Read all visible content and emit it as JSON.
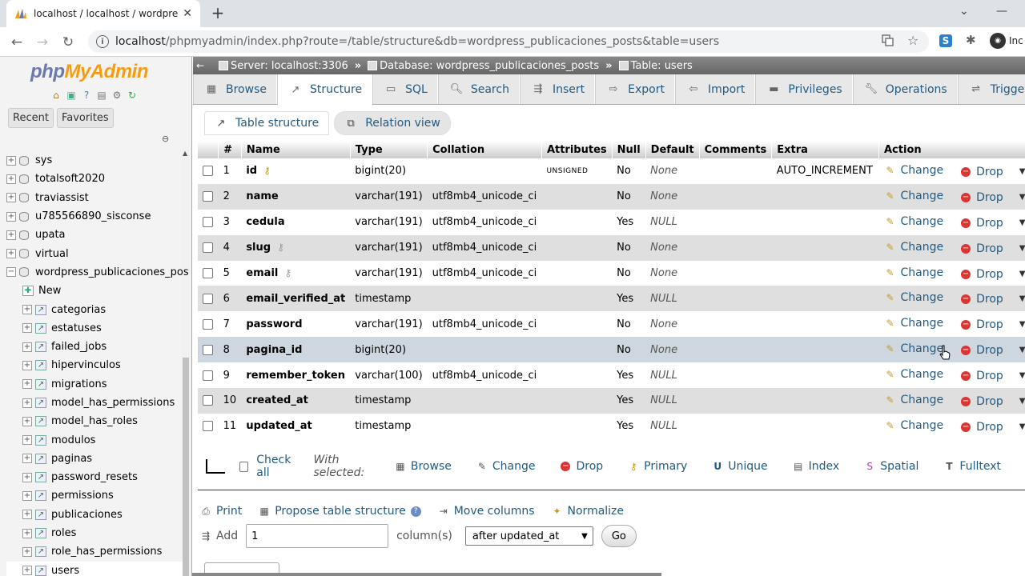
{
  "browser": {
    "tab_title": "localhost / localhost / wordpress",
    "url_host": "localhost",
    "url_path": "/phpmyadmin/index.php?route=/table/structure&db=wordpress_publicaciones_posts&table=users",
    "profile_label": "Inc"
  },
  "pma": {
    "logo_php": "php",
    "logo_my": "My",
    "logo_admin": "Admin",
    "nav_tabs": [
      "Recent",
      "Favorites"
    ],
    "tree": [
      {
        "label": "sys",
        "type": "db"
      },
      {
        "label": "totalsoft2020",
        "type": "db"
      },
      {
        "label": "traviassist",
        "type": "db"
      },
      {
        "label": "u785566890_sisconse",
        "type": "db"
      },
      {
        "label": "upata",
        "type": "db"
      },
      {
        "label": "virtual",
        "type": "db"
      },
      {
        "label": "wordpress_publicaciones_pos",
        "type": "db-open"
      },
      {
        "label": "New",
        "type": "new"
      },
      {
        "label": "categorias",
        "type": "table"
      },
      {
        "label": "estatuses",
        "type": "table"
      },
      {
        "label": "failed_jobs",
        "type": "table"
      },
      {
        "label": "hipervinculos",
        "type": "table"
      },
      {
        "label": "migrations",
        "type": "table"
      },
      {
        "label": "model_has_permissions",
        "type": "table"
      },
      {
        "label": "model_has_roles",
        "type": "table"
      },
      {
        "label": "modulos",
        "type": "table"
      },
      {
        "label": "paginas",
        "type": "table"
      },
      {
        "label": "password_resets",
        "type": "table"
      },
      {
        "label": "permissions",
        "type": "table"
      },
      {
        "label": "publicaciones",
        "type": "table"
      },
      {
        "label": "roles",
        "type": "table"
      },
      {
        "label": "role_has_permissions",
        "type": "table"
      },
      {
        "label": "users",
        "type": "table-active"
      }
    ]
  },
  "breadcrumb": {
    "server": "Server: localhost:3306",
    "database": "Database: wordpress_publicaciones_posts",
    "table": "Table: users"
  },
  "topmenu": [
    {
      "label": "Browse",
      "icon": "browse-icon"
    },
    {
      "label": "Structure",
      "icon": "structure-icon",
      "active": true
    },
    {
      "label": "SQL",
      "icon": "sql-icon"
    },
    {
      "label": "Search",
      "icon": "search-icon"
    },
    {
      "label": "Insert",
      "icon": "insert-icon"
    },
    {
      "label": "Export",
      "icon": "export-icon"
    },
    {
      "label": "Import",
      "icon": "import-icon"
    },
    {
      "label": "Privileges",
      "icon": "privileges-icon"
    },
    {
      "label": "Operations",
      "icon": "operations-icon"
    },
    {
      "label": "Triggers",
      "icon": "triggers-icon"
    }
  ],
  "subtabs": {
    "table_structure": "Table structure",
    "relation_view": "Relation view"
  },
  "table": {
    "headers": [
      "#",
      "Name",
      "Type",
      "Collation",
      "Attributes",
      "Null",
      "Default",
      "Comments",
      "Extra",
      "Action"
    ],
    "rows": [
      {
        "num": "1",
        "name": "id",
        "key": "primary",
        "type": "bigint(20)",
        "collation": "",
        "attributes": "UNSIGNED",
        "null": "No",
        "default": "None",
        "comments": "",
        "extra": "AUTO_INCREMENT"
      },
      {
        "num": "2",
        "name": "name",
        "key": "",
        "type": "varchar(191)",
        "collation": "utf8mb4_unicode_ci",
        "attributes": "",
        "null": "No",
        "default": "None",
        "comments": "",
        "extra": ""
      },
      {
        "num": "3",
        "name": "cedula",
        "key": "",
        "type": "varchar(191)",
        "collation": "utf8mb4_unicode_ci",
        "attributes": "",
        "null": "Yes",
        "default": "NULL",
        "comments": "",
        "extra": ""
      },
      {
        "num": "4",
        "name": "slug",
        "key": "unique",
        "type": "varchar(191)",
        "collation": "utf8mb4_unicode_ci",
        "attributes": "",
        "null": "No",
        "default": "None",
        "comments": "",
        "extra": ""
      },
      {
        "num": "5",
        "name": "email",
        "key": "unique",
        "type": "varchar(191)",
        "collation": "utf8mb4_unicode_ci",
        "attributes": "",
        "null": "No",
        "default": "None",
        "comments": "",
        "extra": ""
      },
      {
        "num": "6",
        "name": "email_verified_at",
        "key": "",
        "type": "timestamp",
        "collation": "",
        "attributes": "",
        "null": "Yes",
        "default": "NULL",
        "comments": "",
        "extra": ""
      },
      {
        "num": "7",
        "name": "password",
        "key": "",
        "type": "varchar(191)",
        "collation": "utf8mb4_unicode_ci",
        "attributes": "",
        "null": "No",
        "default": "None",
        "comments": "",
        "extra": ""
      },
      {
        "num": "8",
        "name": "pagina_id",
        "key": "",
        "type": "bigint(20)",
        "collation": "",
        "attributes": "",
        "null": "No",
        "default": "None",
        "comments": "",
        "extra": ""
      },
      {
        "num": "9",
        "name": "remember_token",
        "key": "",
        "type": "varchar(100)",
        "collation": "utf8mb4_unicode_ci",
        "attributes": "",
        "null": "Yes",
        "default": "NULL",
        "comments": "",
        "extra": ""
      },
      {
        "num": "10",
        "name": "created_at",
        "key": "",
        "type": "timestamp",
        "collation": "",
        "attributes": "",
        "null": "Yes",
        "default": "NULL",
        "comments": "",
        "extra": ""
      },
      {
        "num": "11",
        "name": "updated_at",
        "key": "",
        "type": "timestamp",
        "collation": "",
        "attributes": "",
        "null": "Yes",
        "default": "NULL",
        "comments": "",
        "extra": ""
      }
    ],
    "action_change": "Change",
    "action_drop": "Drop"
  },
  "with_selected": {
    "check_all": "Check all",
    "label": "With selected:",
    "browse": "Browse",
    "change": "Change",
    "drop": "Drop",
    "primary": "Primary",
    "unique": "Unique",
    "index": "Index",
    "spatial": "Spatial",
    "fulltext": "Fulltext"
  },
  "bottom": {
    "print": "Print",
    "propose": "Propose table structure",
    "move_columns": "Move columns",
    "normalize": "Normalize",
    "add": "Add",
    "add_count": "1",
    "columns_label": "column(s)",
    "position_selected": "after updated_at",
    "go": "Go"
  }
}
